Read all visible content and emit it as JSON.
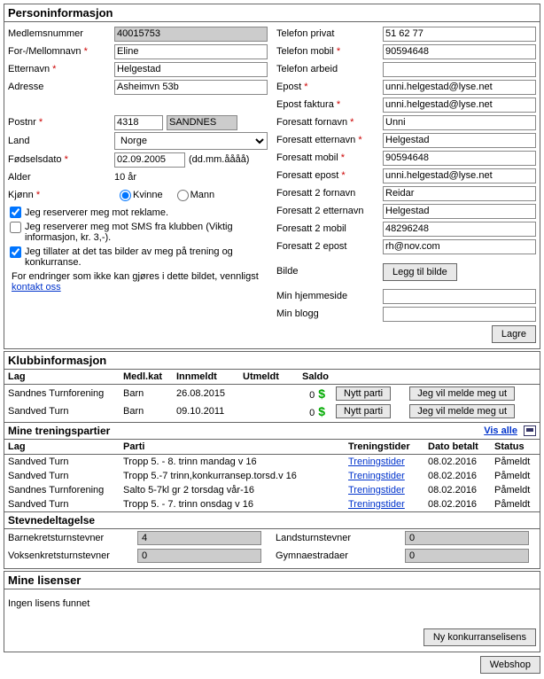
{
  "person": {
    "title": "Personinformasjon",
    "labels": {
      "medlemsnummer": "Medlemsnummer",
      "for_mellom": "For-/Mellomnavn",
      "etternavn": "Etternavn",
      "adresse": "Adresse",
      "postnr": "Postnr",
      "land": "Land",
      "fodselsdato": "Fødselsdato",
      "dateformat": "(dd.mm.åååå)",
      "alder": "Alder",
      "kjonn": "Kjønn",
      "kvinne": "Kvinne",
      "mann": "Mann",
      "reklame": "Jeg reserverer meg mot reklame.",
      "sms": "Jeg reserverer meg mot SMS fra klubben (Viktig informasjon, kr. 3,-).",
      "bilder": "Jeg tillater at det tas bilder av meg på trening og konkurranse.",
      "endringer": "For endringer som ikke kan gjøres i dette bildet, vennligst ",
      "kontakt": "kontakt oss",
      "tlf_privat": "Telefon privat",
      "tlf_mobil": "Telefon mobil",
      "tlf_arbeid": "Telefon arbeid",
      "epost": "Epost",
      "epost_faktura": "Epost faktura",
      "foresatt_fornavn": "Foresatt fornavn",
      "foresatt_etternavn": "Foresatt etternavn",
      "foresatt_mobil": "Foresatt mobil",
      "foresatt_epost": "Foresatt epost",
      "foresatt2_fornavn": "Foresatt 2 fornavn",
      "foresatt2_etternavn": "Foresatt 2 etternavn",
      "foresatt2_mobil": "Foresatt 2 mobil",
      "foresatt2_epost": "Foresatt 2 epost",
      "bilde": "Bilde",
      "legg_til_bilde": "Legg til bilde",
      "min_hjemmeside": "Min hjemmeside",
      "min_blogg": "Min blogg",
      "lagre": "Lagre"
    },
    "values": {
      "medlemsnummer": "40015753",
      "for_mellom": "Eline",
      "etternavn": "Helgestad",
      "adresse": "Asheimvn 53b",
      "postnr": "4318",
      "poststed": "SANDNES",
      "land": "Norge",
      "fodselsdato": "02.09.2005",
      "alder": "10 år",
      "tlf_privat": "51 62 77",
      "tlf_mobil": "90594648",
      "tlf_arbeid": "",
      "epost": "unni.helgestad@lyse.net",
      "epost_faktura": "unni.helgestad@lyse.net",
      "foresatt_fornavn": "Unni",
      "foresatt_etternavn": "Helgestad",
      "foresatt_mobil": "90594648",
      "foresatt_epost": "unni.helgestad@lyse.net",
      "foresatt2_fornavn": "Reidar",
      "foresatt2_etternavn": "Helgestad",
      "foresatt2_mobil": "48296248",
      "foresatt2_epost": "rh@nov.com",
      "min_hjemmeside": "",
      "min_blogg": ""
    }
  },
  "klubb": {
    "title": "Klubbinformasjon",
    "headers": {
      "lag": "Lag",
      "medlkat": "Medl.kat",
      "innmeldt": "Innmeldt",
      "utmeldt": "Utmeldt",
      "saldo": "Saldo"
    },
    "buttons": {
      "nyttparti": "Nytt parti",
      "meldeut": "Jeg vil melde meg ut"
    },
    "rows": [
      {
        "lag": "Sandnes Turnforening",
        "medlkat": "Barn",
        "innmeldt": "26.08.2015",
        "utmeldt": "",
        "saldo": "0"
      },
      {
        "lag": "Sandved Turn",
        "medlkat": "Barn",
        "innmeldt": "09.10.2011",
        "utmeldt": "",
        "saldo": "0"
      }
    ],
    "mine": {
      "title": "Mine treningspartier",
      "visalle": "Vis alle",
      "headers": {
        "lag": "Lag",
        "parti": "Parti",
        "treningstider": "Treningstider",
        "dato": "Dato betalt",
        "status": "Status"
      },
      "link": "Treningstider",
      "rows": [
        {
          "lag": "Sandved Turn",
          "parti": "Tropp 5. - 8. trinn mandag v 16",
          "dato": "08.02.2016",
          "status": "Påmeldt"
        },
        {
          "lag": "Sandved Turn",
          "parti": "Tropp 5.-7 trinn,konkurransep.torsd.v 16",
          "dato": "08.02.2016",
          "status": "Påmeldt"
        },
        {
          "lag": "Sandnes Turnforening",
          "parti": "Salto 5-7kl gr 2 torsdag vår-16",
          "dato": "08.02.2016",
          "status": "Påmeldt"
        },
        {
          "lag": "Sandved Turn",
          "parti": "Tropp 5. - 7. trinn onsdag v 16",
          "dato": "08.02.2016",
          "status": "Påmeldt"
        }
      ]
    },
    "stevne": {
      "title": "Stevnedeltagelse",
      "labels": {
        "barnekrets": "Barnekretsturnstevner",
        "voksenkrets": "Voksenkretsturnstevner",
        "landsturn": "Landsturnstevner",
        "gymnaestradaer": "Gymnaestradaer"
      },
      "values": {
        "barnekrets": "4",
        "voksenkrets": "0",
        "landsturn": "0",
        "gymnaestradaer": "0"
      }
    }
  },
  "lisens": {
    "title": "Mine lisenser",
    "none": "Ingen lisens funnet",
    "ny": "Ny konkurranselisens"
  },
  "webshop": "Webshop"
}
